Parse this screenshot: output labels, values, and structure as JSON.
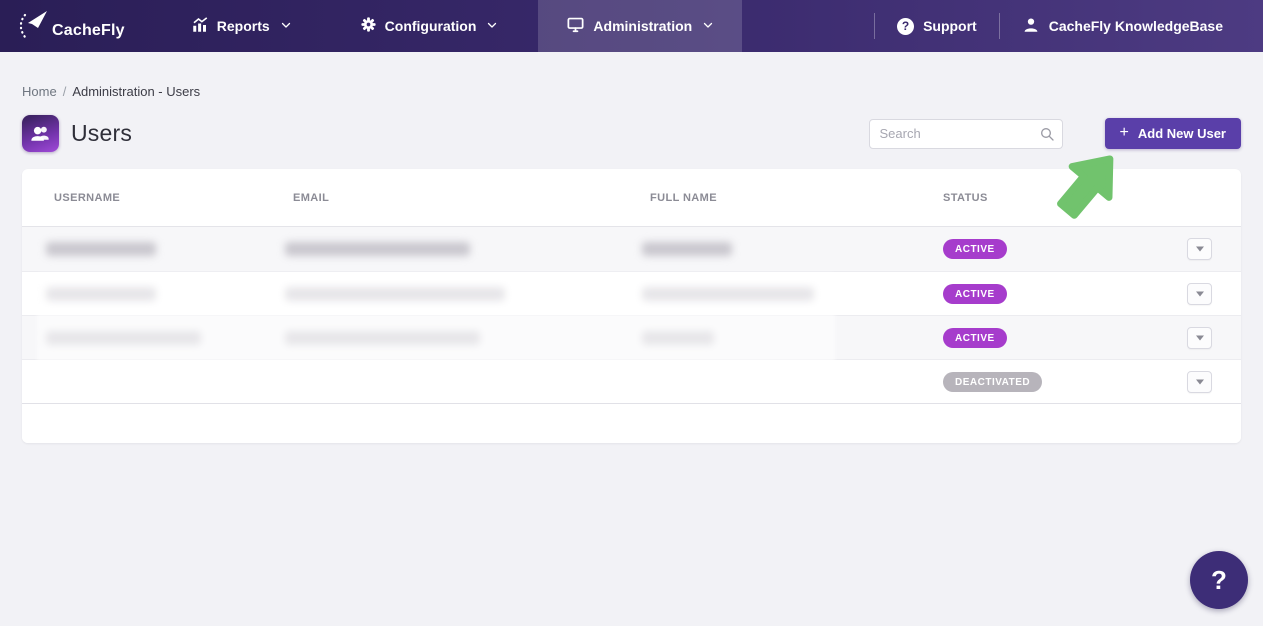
{
  "nav": {
    "brand": "CacheFly",
    "items": [
      {
        "label": "Reports",
        "icon": "bar-chart-icon"
      },
      {
        "label": "Configuration",
        "icon": "gear-icon"
      },
      {
        "label": "Administration",
        "icon": "monitor-icon",
        "active": true
      }
    ],
    "support_label": "Support",
    "support_icon_glyph": "?",
    "account_label": "CacheFly KnowledgeBase"
  },
  "breadcrumb": {
    "home": "Home",
    "separator": "/",
    "current": "Administration - Users"
  },
  "page": {
    "title": "Users"
  },
  "search": {
    "placeholder": "Search"
  },
  "toolbar": {
    "plus": "+",
    "add_user_label": "Add New User"
  },
  "table": {
    "columns": [
      "USERNAME",
      "EMAIL",
      "FULL NAME",
      "STATUS"
    ],
    "rows": [
      {
        "username_redacted": true,
        "email_redacted": true,
        "full_name_redacted": true,
        "status": "ACTIVE"
      },
      {
        "username_redacted": true,
        "email_redacted": true,
        "full_name_redacted": true,
        "status": "ACTIVE"
      },
      {
        "username_redacted": true,
        "email_redacted": true,
        "full_name_redacted": true,
        "status": "ACTIVE"
      },
      {
        "username_redacted": true,
        "email_redacted": true,
        "full_name_redacted": true,
        "status": "DEACTIVATED"
      }
    ]
  },
  "help": {
    "label": "?"
  },
  "colors": {
    "navbar_gradient_start": "#2a1e56",
    "navbar_gradient_end": "#4d3b82",
    "nav_active_overlay": "rgba(255,255,255,0.16)",
    "accent_purple": "#5a3fa9",
    "badge_active": "#a63ccc",
    "badge_deactivated": "#b7b4bb",
    "help_fab": "#3d2d77",
    "cursor_arrow_green": "#71c36d",
    "page_background": "#f2f2f6"
  }
}
